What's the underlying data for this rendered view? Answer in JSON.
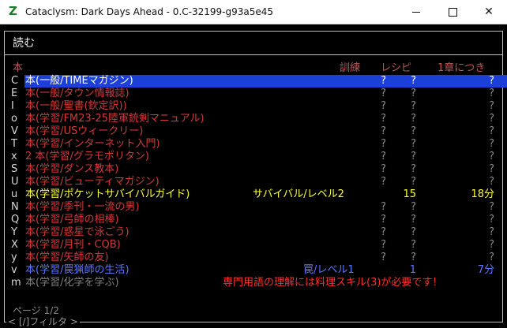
{
  "window": {
    "title": "Cataclysm: Dark Days Ahead - 0.C-32199-g93a5e45",
    "minimize": "",
    "maximize": "",
    "close": "✕"
  },
  "menu": {
    "title": "読む",
    "columns": {
      "name": "本",
      "exercise": "訓練",
      "recipes": "レシピ",
      "time": "1章につき"
    },
    "rows": [
      {
        "hotkey": "C",
        "name": "本(一般/TIMEマガジン)",
        "skill": "",
        "ex": "?",
        "rp": "?",
        "tm": "?",
        "selected": true,
        "color": "white"
      },
      {
        "hotkey": "E",
        "name": "本(一般/タウン情報誌)",
        "skill": "",
        "ex": "?",
        "rp": "?",
        "tm": "?",
        "color": "red"
      },
      {
        "hotkey": "I",
        "name": "本(一般/聖書(欽定訳))",
        "skill": "",
        "ex": "?",
        "rp": "?",
        "tm": "?",
        "color": "red"
      },
      {
        "hotkey": "o",
        "name": "本(学習/FM23-25陸軍銃剣マニュアル)",
        "skill": "",
        "ex": "?",
        "rp": "?",
        "tm": "?",
        "color": "red"
      },
      {
        "hotkey": "V",
        "name": "本(学習/USウィークリー)",
        "skill": "",
        "ex": "?",
        "rp": "?",
        "tm": "?",
        "color": "red"
      },
      {
        "hotkey": "T",
        "name": "本(学習/インターネット入門)",
        "skill": "",
        "ex": "?",
        "rp": "?",
        "tm": "?",
        "color": "red"
      },
      {
        "hotkey": "x",
        "name": "2 本(学習/グラモポリタン)",
        "skill": "",
        "ex": "?",
        "rp": "?",
        "tm": "?",
        "color": "red"
      },
      {
        "hotkey": "S",
        "name": "本(学習/ダンス教本)",
        "skill": "",
        "ex": "?",
        "rp": "?",
        "tm": "?",
        "color": "red"
      },
      {
        "hotkey": "U",
        "name": "本(学習/ビューティマガジン)",
        "skill": "",
        "ex": "?",
        "rp": "?",
        "tm": "?",
        "color": "red"
      },
      {
        "hotkey": "u",
        "name": "本(学習/ポケットサバイバルガイド)",
        "skill": "サバイバル/レベル2",
        "ex": "",
        "rp": "15",
        "tm": "18分",
        "color": "yellow"
      },
      {
        "hotkey": "N",
        "name": "本(学習/季刊・一流の男)",
        "skill": "",
        "ex": "?",
        "rp": "?",
        "tm": "?",
        "color": "red"
      },
      {
        "hotkey": "Q",
        "name": "本(学習/弓師の相棒)",
        "skill": "",
        "ex": "?",
        "rp": "?",
        "tm": "?",
        "color": "red"
      },
      {
        "hotkey": "Y",
        "name": "本(学習/惑星で泳ごう)",
        "skill": "",
        "ex": "?",
        "rp": "?",
        "tm": "?",
        "color": "red"
      },
      {
        "hotkey": "X",
        "name": "本(学習/月刊・CQB)",
        "skill": "",
        "ex": "?",
        "rp": "?",
        "tm": "?",
        "color": "red"
      },
      {
        "hotkey": "y",
        "name": "本(学習/矢師の友)",
        "skill": "",
        "ex": "?",
        "rp": "?",
        "tm": "?",
        "color": "red"
      },
      {
        "hotkey": "v",
        "name": "本(学習/罠猟師の生活)",
        "skill": "罠/レベル1",
        "ex": "",
        "rp": "1",
        "tm": "7分",
        "color": "blue"
      },
      {
        "hotkey": "m",
        "name": "本(学習/化学を学ぶ)",
        "skill": "",
        "ex": "",
        "rp": "",
        "tm": "",
        "warning": "専門用語の理解には料理スキル(3)が必要です！",
        "color": "dim"
      }
    ],
    "page": "ページ 1/2",
    "filter": "< [/]フィルタ >"
  }
}
